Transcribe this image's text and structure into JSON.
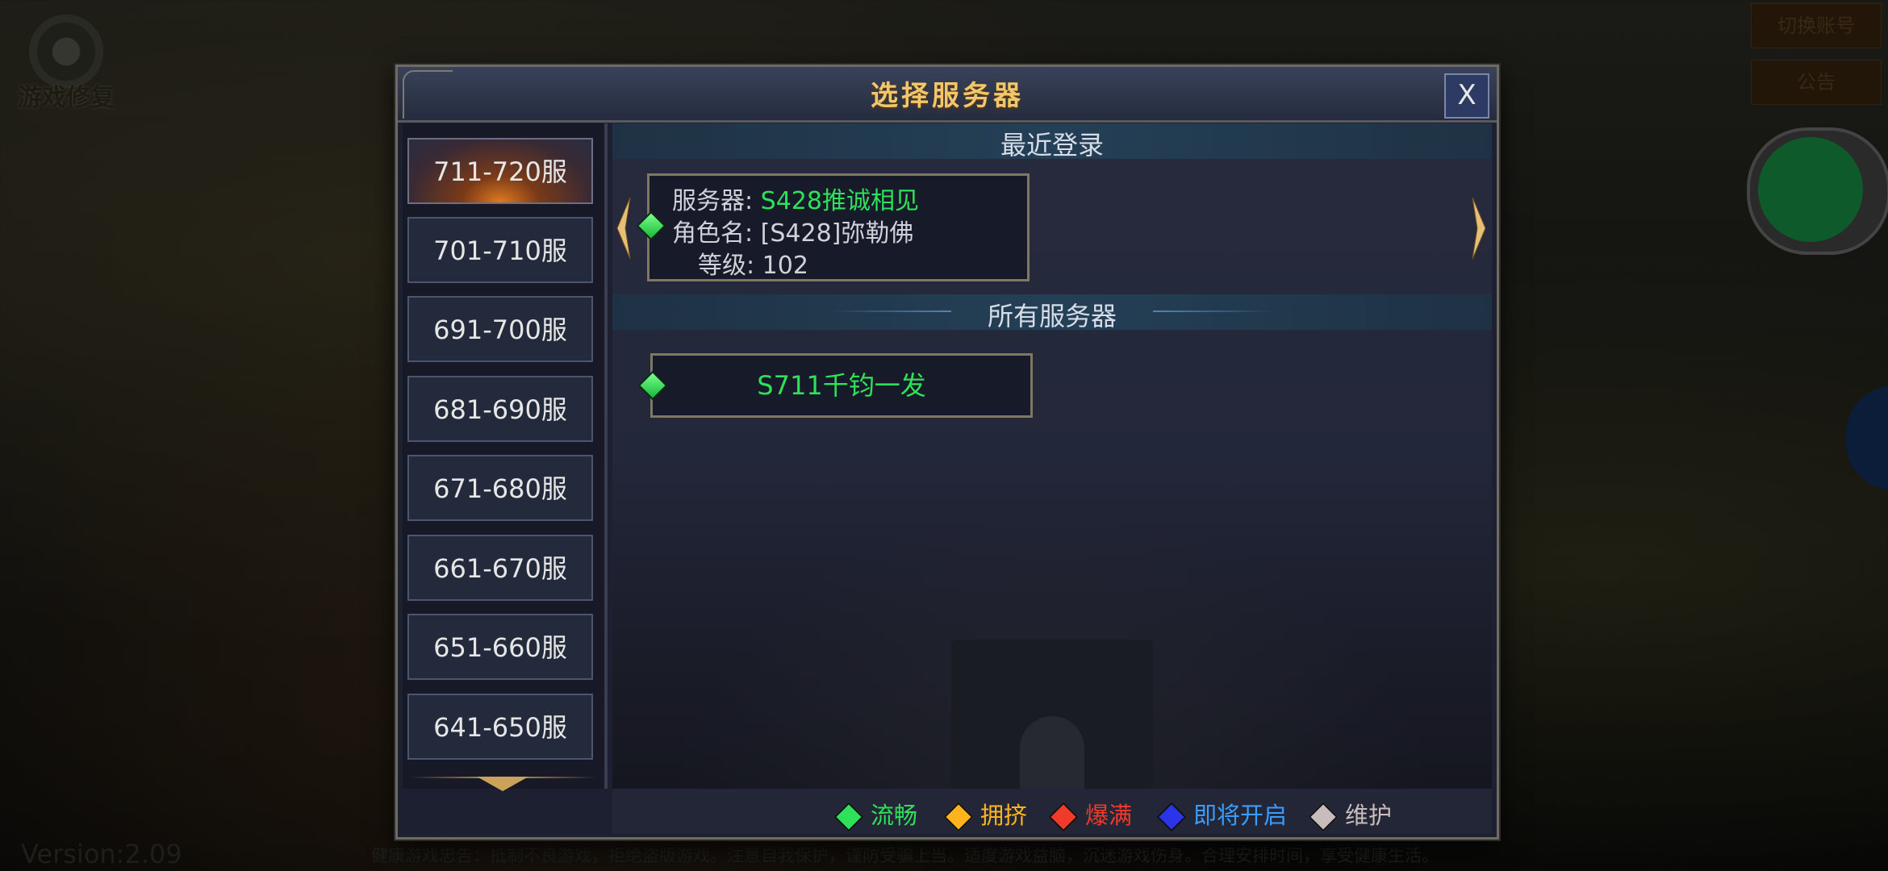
{
  "background": {
    "repair_label": "游戏修复",
    "version": "Version:2.09",
    "notice": "健康游戏忠告：抵制不良游戏，拒绝盗版游戏。注意自我保护，谨防受骗上当。适度游戏益脑，沉迷游戏伤身。合理安排时间，享受健康生活。",
    "top_right_buttons": [
      "切换账号",
      "公告"
    ]
  },
  "modal": {
    "title": "选择服务器",
    "close_label": "X"
  },
  "sidebar": {
    "items": [
      {
        "label": "711-720服",
        "active": true
      },
      {
        "label": "701-710服"
      },
      {
        "label": "691-700服"
      },
      {
        "label": "681-690服"
      },
      {
        "label": "671-680服"
      },
      {
        "label": "661-670服"
      },
      {
        "label": "651-660服"
      },
      {
        "label": "641-650服"
      }
    ]
  },
  "recent": {
    "title": "最近登录",
    "server_label": "服务器:",
    "server_value": "S428推诚相见",
    "role_label": "角色名:",
    "role_value": "[S428]弥勒佛",
    "level_label": "等级:",
    "level_value": "102",
    "status_color": "#2fe05a"
  },
  "all_servers": {
    "title": "所有服务器",
    "items": [
      {
        "name": "S711千钧一发",
        "status": "流畅"
      }
    ]
  },
  "legend": [
    {
      "label": "流畅",
      "color": "#2fe05a"
    },
    {
      "label": "拥挤",
      "color": "#ffb41e"
    },
    {
      "label": "爆满",
      "color": "#f03a2a"
    },
    {
      "label": "即将开启",
      "color": "#3a9cff"
    },
    {
      "label": "维护",
      "color": "#c8bcbc"
    }
  ],
  "colors": {
    "title_gold": "#f2c66a",
    "panel_bg": "#1d2030",
    "frame": "#7e7762"
  }
}
